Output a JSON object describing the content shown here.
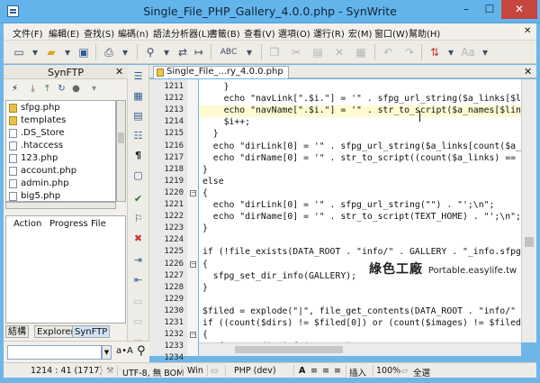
{
  "window": {
    "title": "Single_File_PHP_Gallery_4.0.0.php - SynWrite",
    "minimize_label": "–",
    "maximize_label": "☐",
    "close_label": "✕"
  },
  "menu": [
    "文件(F)",
    "編輯(E)",
    "查找(S)",
    "編碼(n)",
    "語法分析器(L)",
    "書籤(B)",
    "查看(V)",
    "選項(O)",
    "運行(R)",
    "宏(M)",
    "窗口(W)",
    "幫助(H)"
  ],
  "menu_close": "✕",
  "ftp": {
    "title": "SynFTP",
    "close_label": "✕",
    "files": [
      {
        "name": "sfpg.php",
        "kind": "php"
      },
      {
        "name": "templates",
        "kind": "folder"
      },
      {
        "name": ".DS_Store",
        "kind": "doc"
      },
      {
        "name": ".htaccess",
        "kind": "doc"
      },
      {
        "name": "123.php",
        "kind": "doc"
      },
      {
        "name": "account.php",
        "kind": "doc"
      },
      {
        "name": "admin.php",
        "kind": "doc"
      },
      {
        "name": "big5.php",
        "kind": "doc"
      }
    ],
    "columns": [
      "Action",
      "Progress",
      "File"
    ]
  },
  "panel_tabs": [
    "結構",
    "Explorer",
    "SynFTP"
  ],
  "editor": {
    "tab_label": "Single_File_...ry_4.0.0.php",
    "tab_close": "✕",
    "code_lines": [
      {
        "n": "1211",
        "text": "    }",
        "fold": ""
      },
      {
        "n": "1212",
        "text": "    echo \"navLink[\".$i.\"] = '\" . sfpg_url_string($a_links[$lin",
        "fold": ""
      },
      {
        "n": "1213",
        "text": "    echo \"navName[\".$i.\"] = '\" . str_to_script($a_names[$link_",
        "fold": ""
      },
      {
        "n": "1214",
        "text": "    $i++;",
        "fold": ""
      },
      {
        "n": "1215",
        "text": "  }",
        "fold": ""
      },
      {
        "n": "1216",
        "text": "  echo \"dirLink[0] = '\" . sfpg_url_string($a_links[count($a_li",
        "fold": ""
      },
      {
        "n": "1217",
        "text": "  echo \"dirName[0] = '\" . str_to_script((count($a_links) == 0",
        "fold": ""
      },
      {
        "n": "1218",
        "text": "}",
        "fold": ""
      },
      {
        "n": "1219",
        "text": "else",
        "fold": ""
      },
      {
        "n": "1220",
        "text": "{",
        "fold": "−"
      },
      {
        "n": "1221",
        "text": "  echo \"dirLink[0] = '\" . sfpg_url_string(\"\") . \"';\\n\";",
        "fold": ""
      },
      {
        "n": "1222",
        "text": "  echo \"dirName[0] = '\" . str_to_script(TEXT_HOME) . \"';\\n\";",
        "fold": ""
      },
      {
        "n": "1223",
        "text": "}",
        "fold": ""
      },
      {
        "n": "1224",
        "text": "",
        "fold": ""
      },
      {
        "n": "1225",
        "text": "if (!file_exists(DATA_ROOT . \"info/\" . GALLERY . \"_info.sfpg\")",
        "fold": ""
      },
      {
        "n": "1226",
        "text": "{",
        "fold": "−"
      },
      {
        "n": "1227",
        "text": "  sfpg_set_dir_info(GALLERY);",
        "fold": ""
      },
      {
        "n": "1228",
        "text": "}",
        "fold": ""
      },
      {
        "n": "1229",
        "text": "",
        "fold": ""
      },
      {
        "n": "1230",
        "text": "$filed = explode(\"|\", file_get_contents(DATA_ROOT . \"info/\" .",
        "fold": ""
      },
      {
        "n": "1231",
        "text": "if ((count($dirs) != $filed[0]) or (count($images) != $filed[1",
        "fold": ""
      },
      {
        "n": "1232",
        "text": "{",
        "fold": "−"
      },
      {
        "n": "1233",
        "text": "  sfpg_set_dir_info(GALLERY);",
        "fold": ""
      },
      {
        "n": "1234",
        "text": "  $filed = explode(\"|\", file_get_contents(DATA_ROOT . \"info/\"",
        "fold": ""
      }
    ]
  },
  "find": {
    "value": "",
    "aa_label": "a•A"
  },
  "watermark": {
    "text": "綠色工廠",
    "sub": "Portable.easylife.tw"
  },
  "status": {
    "position": "1214 : 41 (1717)",
    "encoding": "UTF-8, 無 BOM",
    "eol": "Win",
    "lexer": "PHP (dev)",
    "insert_mode": "插入",
    "zoom": "100%",
    "lang": "全選"
  }
}
